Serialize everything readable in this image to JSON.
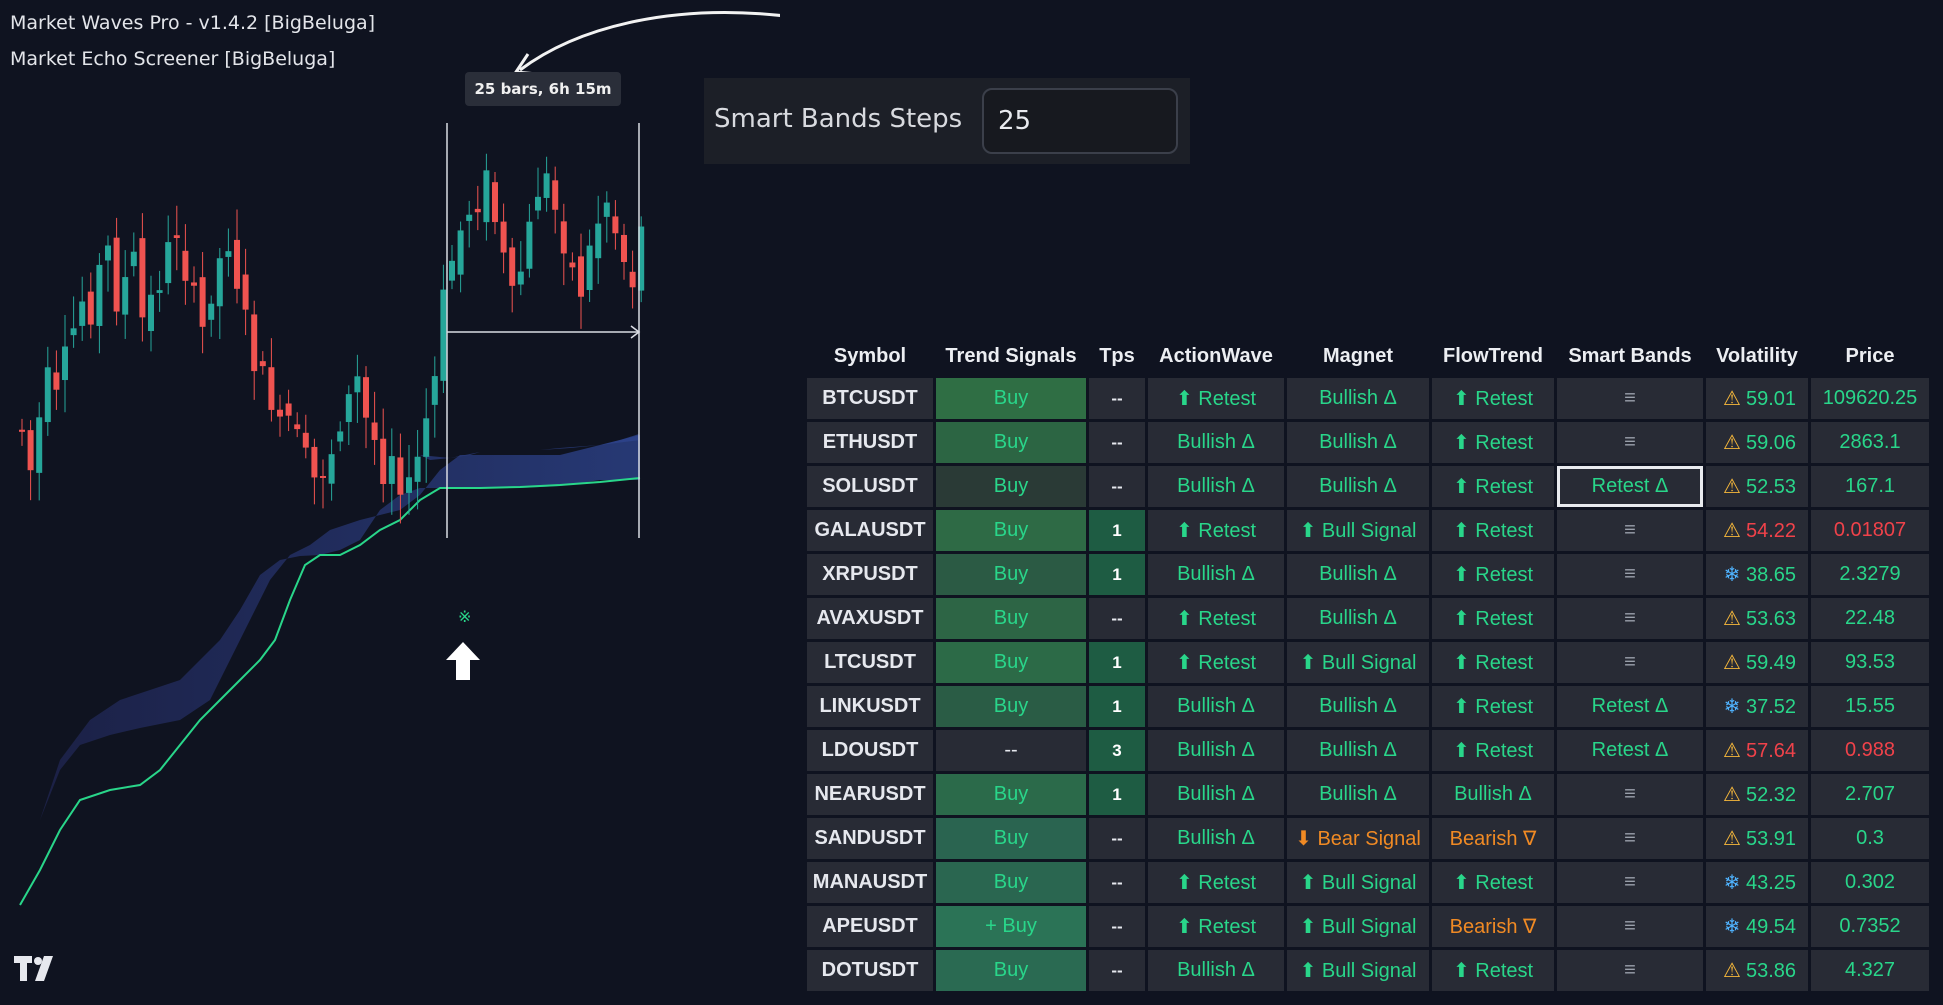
{
  "indicators": [
    "Market Waves Pro - v1.4.2 [BigBeluga]",
    "Market Echo Screener [BigBeluga]"
  ],
  "measure_label": "25 bars, 6h 15m",
  "settings": {
    "label": "Smart Bands Steps",
    "value": "25"
  },
  "colors": {
    "bg": "#0f1320",
    "green": "#29d68a",
    "red": "#f0424a",
    "orange": "#f08a24",
    "band": "#2a3a78"
  },
  "screener": {
    "headers": [
      "Symbol",
      "Trend Signals",
      "Tps",
      "ActionWave",
      "Magnet",
      "FlowTrend",
      "Smart Bands",
      "Volatility",
      "Price"
    ],
    "rows": [
      {
        "symbol": "BTCUSDT",
        "trend": "Buy",
        "tps": "--",
        "action": "⬆ Retest",
        "magnet": "Bullish Δ",
        "flow": "⬆ Retest",
        "bands": "≡",
        "vol_icon": "warning",
        "vol": "59.01",
        "price": "109620.25",
        "trend_bg": "#2f6e44"
      },
      {
        "symbol": "ETHUSDT",
        "trend": "Buy",
        "tps": "--",
        "action": "Bullish Δ",
        "magnet": "Bullish Δ",
        "flow": "⬆ Retest",
        "bands": "≡",
        "vol_icon": "warning",
        "vol": "59.06",
        "price": "2863.1",
        "trend_bg": "#2c6543"
      },
      {
        "symbol": "SOLUSDT",
        "trend": "Buy",
        "tps": "--",
        "action": "Bullish Δ",
        "magnet": "Bullish Δ",
        "flow": "⬆ Retest",
        "bands": "Retest Δ",
        "vol_icon": "warning",
        "vol": "52.53",
        "price": "167.1",
        "trend_bg": "#2a3a36",
        "highlight": true
      },
      {
        "symbol": "GALAUSDT",
        "trend": "Buy",
        "tps": "1",
        "action": "⬆ Retest",
        "magnet": "⬆ Bull Signal",
        "flow": "⬆ Retest",
        "bands": "≡",
        "vol_icon": "warning",
        "vol": "54.22",
        "price": "0.01807",
        "red": true,
        "trend_bg": "#2e6a45"
      },
      {
        "symbol": "XRPUSDT",
        "trend": "Buy",
        "tps": "1",
        "action": "Bullish Δ",
        "magnet": "Bullish Δ",
        "flow": "⬆ Retest",
        "bands": "≡",
        "vol_icon": "snowflake",
        "vol": "38.65",
        "price": "2.3279",
        "trend_bg": "#2b5a44"
      },
      {
        "symbol": "AVAXUSDT",
        "trend": "Buy",
        "tps": "--",
        "action": "⬆ Retest",
        "magnet": "Bullish Δ",
        "flow": "⬆ Retest",
        "bands": "≡",
        "vol_icon": "warning",
        "vol": "53.63",
        "price": "22.48",
        "trend_bg": "#2d6545"
      },
      {
        "symbol": "LTCUSDT",
        "trend": "Buy",
        "tps": "1",
        "action": "⬆ Retest",
        "magnet": "⬆ Bull Signal",
        "flow": "⬆ Retest",
        "bands": "≡",
        "vol_icon": "warning",
        "vol": "59.49",
        "price": "93.53",
        "trend_bg": "#2c6a47"
      },
      {
        "symbol": "LINKUSDT",
        "trend": "Buy",
        "tps": "1",
        "action": "Bullish Δ",
        "magnet": "Bullish Δ",
        "flow": "⬆ Retest",
        "bands": "Retest Δ",
        "vol_icon": "snowflake",
        "vol": "37.52",
        "price": "15.55",
        "trend_bg": "#2a5c45"
      },
      {
        "symbol": "LDOUSDT",
        "trend": "--",
        "tps": "3",
        "action": "Bullish Δ",
        "magnet": "Bullish Δ",
        "flow": "⬆ Retest",
        "bands": "Retest Δ",
        "vol_icon": "warning",
        "vol": "57.64",
        "price": "0.988",
        "red": true,
        "trend_bg": "#282b35"
      },
      {
        "symbol": "NEARUSDT",
        "trend": "Buy",
        "tps": "1",
        "action": "Bullish Δ",
        "magnet": "Bullish Δ",
        "flow": "Bullish Δ",
        "bands": "≡",
        "vol_icon": "warning",
        "vol": "52.32",
        "price": "2.707",
        "trend_bg": "#2b6a4a"
      },
      {
        "symbol": "SANDUSDT",
        "trend": "Buy",
        "tps": "--",
        "action": "Bullish Δ",
        "magnet": "⬇ Bear Signal",
        "flow": "Bearish ∇",
        "bands": "≡",
        "vol_icon": "warning",
        "vol": "53.91",
        "price": "0.3",
        "magnet_bear": true,
        "flow_bear": true,
        "trend_bg": "#2a6450"
      },
      {
        "symbol": "MANAUSDT",
        "trend": "Buy",
        "tps": "--",
        "action": "⬆ Retest",
        "magnet": "⬆ Bull Signal",
        "flow": "⬆ Retest",
        "bands": "≡",
        "vol_icon": "snowflake",
        "vol": "43.25",
        "price": "0.302",
        "trend_bg": "#2a6650"
      },
      {
        "symbol": "APEUSDT",
        "trend": "+ Buy",
        "tps": "--",
        "action": "⬆ Retest",
        "magnet": "⬆ Bull Signal",
        "flow": "Bearish ∇",
        "bands": "≡",
        "vol_icon": "snowflake",
        "vol": "49.54",
        "price": "0.7352",
        "flow_bear": true,
        "trend_bg": "#2b7356"
      },
      {
        "symbol": "DOTUSDT",
        "trend": "Buy",
        "tps": "--",
        "action": "Bullish Δ",
        "magnet": "⬆ Bull Signal",
        "flow": "⬆ Retest",
        "bands": "≡",
        "vol_icon": "warning",
        "vol": "53.86",
        "price": "4.327",
        "trend_bg": "#2a6a52"
      }
    ]
  }
}
